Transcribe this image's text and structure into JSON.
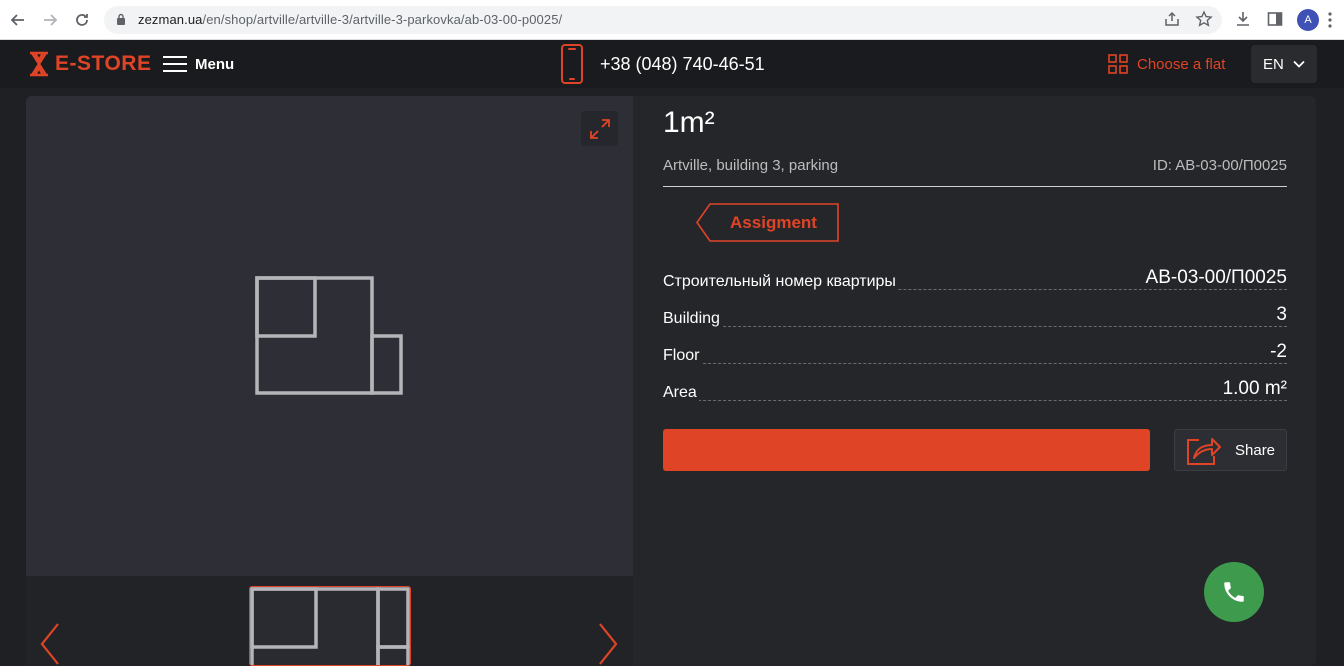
{
  "browser": {
    "url_host": "zezman.ua",
    "url_path": "/en/shop/artville/artville-3/artville-3-parkovka/ab-03-00-p0025/",
    "avatar_letter": "A"
  },
  "header": {
    "logo_text": "E-STORE",
    "menu_label": "Menu",
    "phone": "+38 (048) 740-46-51",
    "choose_flat": "Choose a flat",
    "language": "EN"
  },
  "listing": {
    "title": "1m²",
    "subtitle": "Artville, building 3, parking",
    "id_text": "ID: AB-03-00/П0025",
    "assign_label": "Assigment",
    "specs": [
      {
        "label": "Строительный номер квартиры",
        "value": "AB-03-00/П0025"
      },
      {
        "label": "Building",
        "value": "3"
      },
      {
        "label": "Floor",
        "value": "-2"
      },
      {
        "label": "Area",
        "value": "1.00 m²"
      }
    ],
    "share_label": "Share"
  },
  "colors": {
    "accent": "#e04426",
    "background": "#1f2024",
    "card": "#25262a",
    "call_button": "#3e9a4d"
  }
}
